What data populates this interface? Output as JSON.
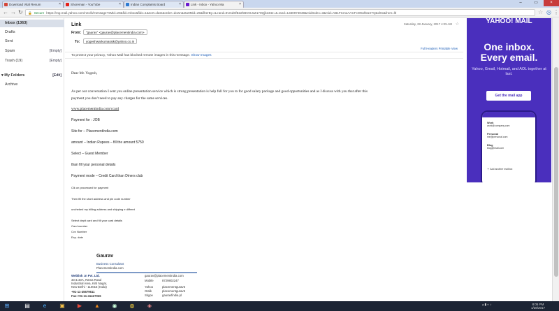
{
  "tabs": [
    {
      "title": "Download Vital Resum",
      "color": "#d44638"
    },
    {
      "title": "Shoreman - YouTube",
      "color": "#e62117"
    },
    {
      "title": "Indian Complaints Board",
      "color": "#2e7bd2"
    },
    {
      "title": "Link - Inbox - Yahoo Ma",
      "color": "#6a1ad0"
    }
  ],
  "address": {
    "secure_label": "Secure",
    "url": "https://mg.mail.yahoo.com/neo/b/message?sMid=28&fid=Inbox&fidx=1&sort=date&order=down&startMid=25&filterBy=&.rand=8vmdSfB32hBOOJxZ170Qjk234e=&.rand=1330973038&midIndex=3&mid=AB1FCmoAACFcW5xfDaXTQ&vl0x&from=ltl"
  },
  "sidebar": {
    "items": [
      {
        "label": "Inbox (1363)",
        "action": ""
      },
      {
        "label": "Drafts",
        "action": ""
      },
      {
        "label": "Sent",
        "action": ""
      },
      {
        "label": "Spam",
        "action": "[Empty]"
      },
      {
        "label": "Trash (19)",
        "action": "[Empty]"
      }
    ],
    "myfolders": {
      "label": "My Folders",
      "action": "[Edit]"
    },
    "archive": "Archive"
  },
  "message": {
    "subject": "Link",
    "from_label": "From:",
    "from_value": "\"gaurav\" <gaurav@placementindia.com>",
    "to_label": "To:",
    "to_value": "yogeshwarkumaratk@yahoo.co.in",
    "date": "Saturday, 28 January, 2017 4:25 AM",
    "header_links": "Full Headers  Printable View",
    "notice_text": "To protect your privacy, Yahoo Mail has blocked remote images in this message.",
    "notice_link": "Show Images",
    "greeting": "Dear Mr. Yogesh,",
    "para1_line1": "As per our conversation I sent you online presentation service which is strong presentation is help full for you to for good salary package and good opportunities and as I discuss with you that after this",
    "para1_line2": "payment you don't need to pay any charges for the same services.",
    "link": "www.placementindia.com/ccard",
    "payment_for": "Payment for : JOB",
    "site_for": "Site for – PlacementIndia.com",
    "amount": "amount – Indian Rupees – fill the amount 5750",
    "select": "Select – Guest Member",
    "fill_details": "than fill your personal details",
    "payment_mode": "Payment mode – Credit Card than Diners club",
    "clk": "Clk on processed for payment",
    "then_fill": "Then fill the short address and pin code number",
    "uncheck": "uncheked my billing address and shipping e diffrent",
    "select_debit": "Select depit card and fill your card details",
    "card_number": "Card number",
    "cvv": "Cvv Number",
    "exp": "Exp. date"
  },
  "signature": {
    "name": "Gaurav",
    "title": "Business Consultant",
    "site": "Placementindia.com",
    "company": "Weblink .In Pvt. Ltd.",
    "addr1": "33 & 33A, Rama Road",
    "addr2": "Industrial Area, Kirti Nagar,",
    "addr3": "New Delhi - 110015 (India)",
    "phone1": "+91-11-45679611",
    "fax": "Fax:+91-11-41427026",
    "email": "gaurav@placementindia.com",
    "mobile_label": "Mobile",
    "mobile": "8729802247",
    "yahoo_label": "Yahoo",
    "yahoo": "placementgurav5",
    "gtalk_label": "Gtalk",
    "gtalk": "placementgurav5",
    "skype_label": "Skype",
    "skype": "gauravfindia.pl"
  },
  "ad": {
    "logo": "YAHOO! MAIL",
    "headline1": "One inbox.",
    "headline2": "Every email.",
    "sub": "Yahoo, Gmail, Hotmail, and AOL together at last.",
    "button": "Get the mail app",
    "rows": [
      {
        "name": "Work",
        "sub": "work@company.com"
      },
      {
        "name": "Personal",
        "sub": "me@personal.com"
      },
      {
        "name": "Blog",
        "sub": "blog@mail.com"
      }
    ],
    "add": "Add another mailbox"
  },
  "taskbar": {
    "time": "8:05 PM",
    "date": "1/28/2017"
  }
}
